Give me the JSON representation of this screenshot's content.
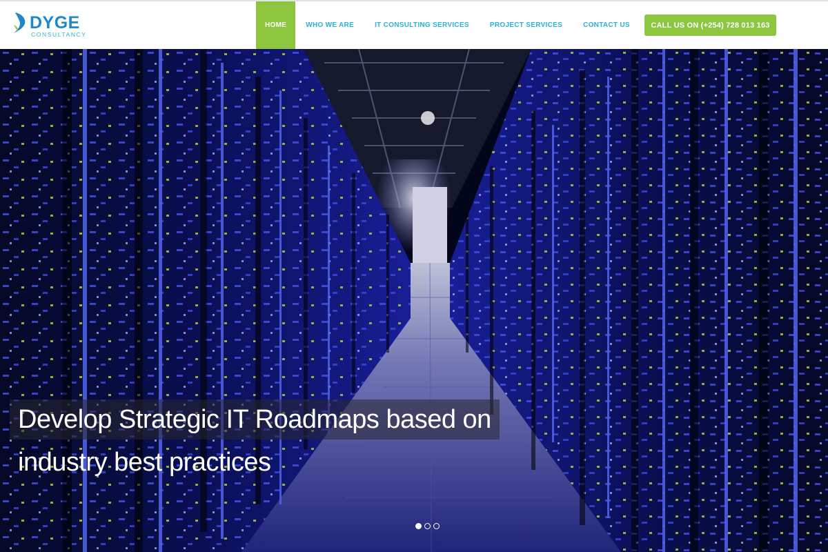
{
  "brand": {
    "name": "DYGE",
    "tagline": "CONSULTANCY",
    "colors": {
      "primary": "#1e88c9",
      "accent": "#8cc63e",
      "nav_link": "#2ab3d6"
    }
  },
  "nav": {
    "items": [
      {
        "label": "HOME",
        "active": true
      },
      {
        "label": "WHO WE ARE",
        "active": false
      },
      {
        "label": "IT CONSULTING SERVICES",
        "active": false
      },
      {
        "label": "PROJECT SERVICES",
        "active": false
      },
      {
        "label": "CONTACT US",
        "active": false
      }
    ]
  },
  "cta": {
    "label": "CALL US ON (+254) 728 013 163"
  },
  "hero": {
    "caption_line1": "Develop Strategic IT Roadmaps based on",
    "caption_line2": "industry best practices",
    "slides_total": 3,
    "active_slide": 1
  }
}
